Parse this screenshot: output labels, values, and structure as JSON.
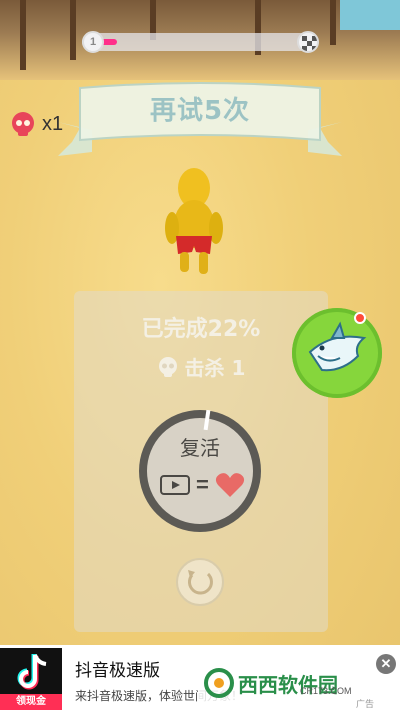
{
  "hud": {
    "progress_level": "1",
    "progress_fraction": 0.1,
    "progress_color": "#ff2f8a",
    "skull_icon": "skull-icon",
    "skull_count": "x1"
  },
  "banner": {
    "text": "再试5次"
  },
  "result": {
    "completion": "已完成22%",
    "kills": "击杀 1"
  },
  "revive": {
    "label": "复活",
    "icons": [
      "video-icon",
      "heart-icon"
    ],
    "equals": "="
  },
  "buttons": {
    "replay_icon": "replay-icon",
    "shark_icon": "shark-icon"
  },
  "ad": {
    "title": "抖音极速版",
    "description": "来抖音极速版，体验世间万象！",
    "logo_badge": "领现金",
    "close": "✕",
    "tag": "广告"
  },
  "watermark": {
    "name": "西西软件园",
    "domain": "CR173.COM"
  }
}
